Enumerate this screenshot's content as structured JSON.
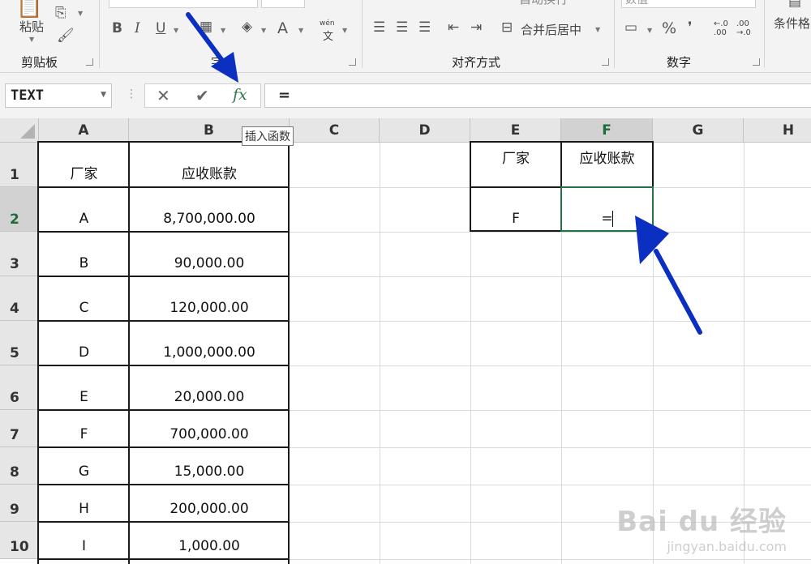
{
  "ribbon": {
    "clipboard": {
      "paste_label": "粘贴",
      "group_label": "剪贴板"
    },
    "font": {
      "group_label": "字",
      "bold": "B",
      "italic": "I",
      "underline": "U",
      "font_color": "A",
      "phonetic_top": "wén",
      "phonetic_bottom": "文"
    },
    "alignment": {
      "group_label": "对齐方式",
      "merge_label": "合并后居中",
      "wrap_label": "自动换行"
    },
    "number": {
      "group_label": "数字",
      "format_value": "数值",
      "percent": "%",
      "comma": "❜",
      "inc_decimal": "←.0\n.00",
      "dec_decimal": ".00\n→.0"
    },
    "styles": {
      "cond_format_label": "条件格"
    }
  },
  "formula_bar": {
    "name_box": "TEXT",
    "cancel": "✕",
    "enter": "✔",
    "fx": "fx",
    "content": "=",
    "tooltip": "插入函数"
  },
  "columns": [
    "A",
    "B",
    "C",
    "D",
    "E",
    "F",
    "G",
    "H"
  ],
  "rows": [
    "1",
    "2",
    "3",
    "4",
    "5",
    "6",
    "7",
    "8",
    "9",
    "10"
  ],
  "table1": {
    "header": [
      "厂家",
      "应收账款"
    ],
    "rows": [
      [
        "A",
        "8,700,000.00"
      ],
      [
        "B",
        "90,000.00"
      ],
      [
        "C",
        "120,000.00"
      ],
      [
        "D",
        "1,000,000.00"
      ],
      [
        "E",
        "20,000.00"
      ],
      [
        "F",
        "700,000.00"
      ],
      [
        "G",
        "15,000.00"
      ],
      [
        "H",
        "200,000.00"
      ],
      [
        "I",
        "1,000.00"
      ]
    ]
  },
  "table2": {
    "header": [
      "厂家",
      "应收账款"
    ],
    "row": [
      "F",
      "="
    ]
  },
  "watermark": {
    "brand": "Bai du 经验",
    "url": "jingyan.baidu.com"
  },
  "colors": {
    "accent": "#217346",
    "arrow": "#0b2fc0"
  }
}
